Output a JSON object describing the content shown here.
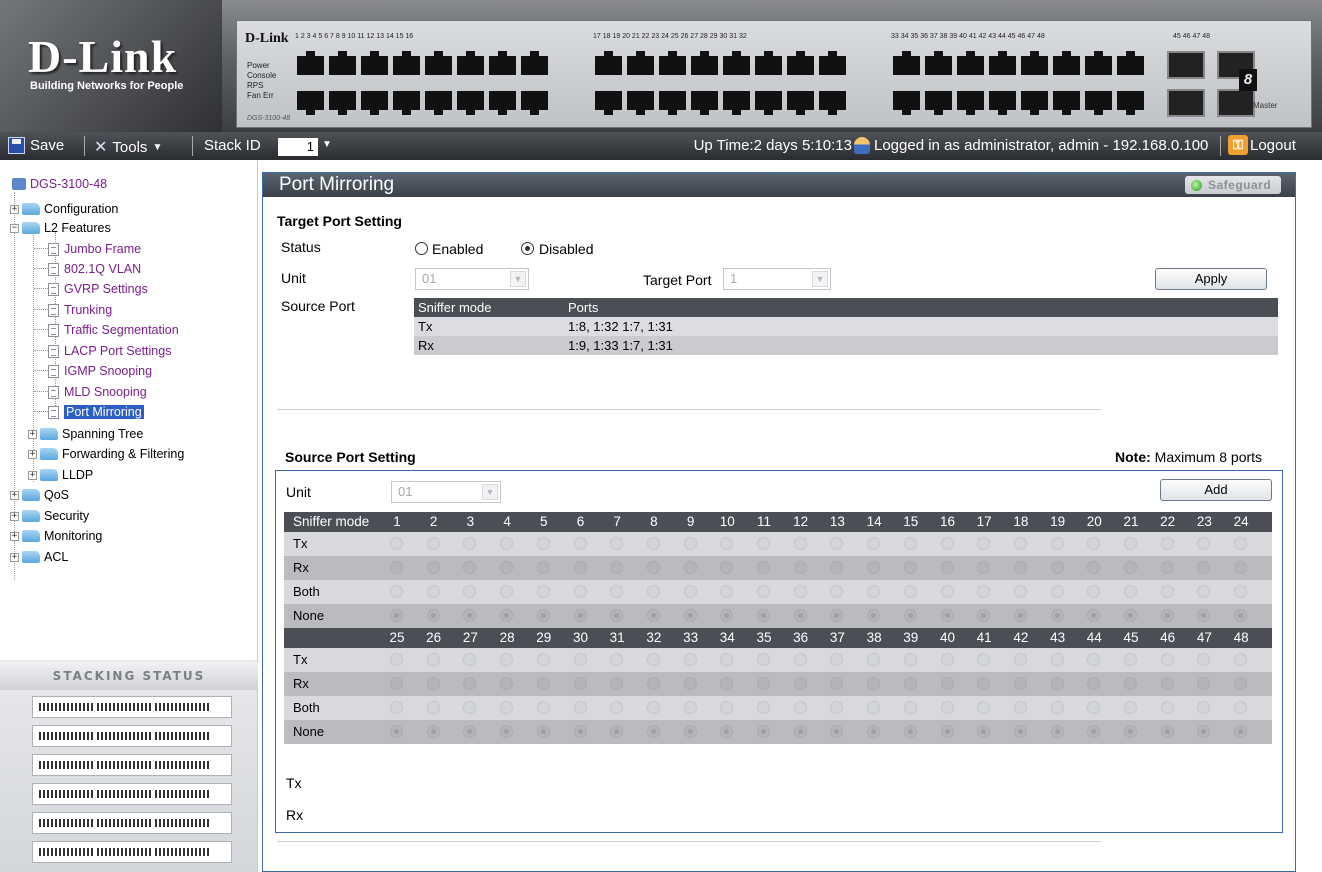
{
  "header": {
    "logo_main": "D-Link",
    "logo_tagline": "Building Networks for People",
    "device_brand": "D-Link",
    "device_model": "DGS-3100-48",
    "device_leds": [
      "Power",
      "Console",
      "RPS",
      "Fan Err"
    ],
    "port_numbers_g1": "1 2 3 4 5 6 7 8 9 10 11 12 13 14 15 16",
    "port_numbers_g2": "17 18 19 20 21 22 23 24 25 26 27 28 29 30 31 32",
    "port_numbers_g3": "33 34 35 36 37 38 39 40 41 42 43 44 45 46 47 48",
    "combo_numbers": "45 46   47 48",
    "seven_seg": "8",
    "master_label": "Master"
  },
  "toolbar": {
    "save_label": "Save",
    "tools_label": "Tools",
    "stack_id_label": "Stack ID",
    "stack_id_value": "1",
    "uptime": "Up Time:2 days 5:10:13",
    "login_text": "Logged in as administrator, admin - 192.168.0.100",
    "logout_label": "Logout"
  },
  "tree": {
    "root": "DGS-3100-48",
    "configuration": "Configuration",
    "l2_features": "L2 Features",
    "l2_items": [
      "Jumbo Frame",
      "802.1Q VLAN",
      "GVRP Settings",
      "Trunking",
      "Traffic Segmentation",
      "LACP Port Settings",
      "IGMP Snooping",
      "MLD Snooping",
      "Port Mirroring"
    ],
    "l2_subfolders": [
      "Spanning Tree",
      "Forwarding & Filtering",
      "LLDP"
    ],
    "bottom_folders": [
      "QoS",
      "Security",
      "Monitoring",
      "ACL"
    ],
    "selected": "Port Mirroring"
  },
  "stacking": {
    "title": "Stacking Status",
    "unit_count": 6
  },
  "main": {
    "title": "Port Mirroring",
    "safeguard": "Safeguard",
    "target_section": "Target Port Setting",
    "status_label": "Status",
    "enabled_label": "Enabled",
    "disabled_label": "Disabled",
    "status_value": "Disabled",
    "unit_label": "Unit",
    "unit_value": "01",
    "target_port_label": "Target Port",
    "target_port_value": "1",
    "apply_label": "Apply",
    "source_port_label": "Source Port",
    "source_table": {
      "headers": [
        "Sniffer mode",
        "Ports"
      ],
      "rows": [
        {
          "mode": "Tx",
          "ports": "1:8, 1:32 1:7, 1:31"
        },
        {
          "mode": "Rx",
          "ports": "1:9, 1:33 1:7, 1:31"
        }
      ]
    },
    "source_section": "Source Port Setting",
    "note_label": "Note:",
    "note_text": "Maximum 8 ports",
    "sps_unit_label": "Unit",
    "sps_unit_value": "01",
    "add_label": "Add",
    "sniffer_header": "Sniffer mode",
    "ports_row1": [
      "1",
      "2",
      "3",
      "4",
      "5",
      "6",
      "7",
      "8",
      "9",
      "10",
      "11",
      "12",
      "13",
      "14",
      "15",
      "16",
      "17",
      "18",
      "19",
      "20",
      "21",
      "22",
      "23",
      "24"
    ],
    "ports_row2": [
      "25",
      "26",
      "27",
      "28",
      "29",
      "30",
      "31",
      "32",
      "33",
      "34",
      "35",
      "36",
      "37",
      "38",
      "39",
      "40",
      "41",
      "42",
      "43",
      "44",
      "45",
      "46",
      "47",
      "48"
    ],
    "modes": [
      "Tx",
      "Rx",
      "Both",
      "None"
    ],
    "selected_mode": "None",
    "footer_tx": "Tx",
    "footer_rx": "Rx"
  }
}
